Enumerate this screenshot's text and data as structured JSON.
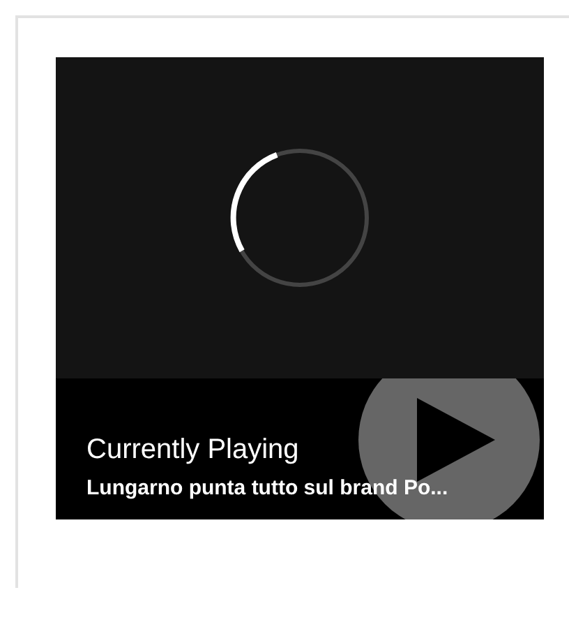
{
  "player": {
    "loading": true,
    "caption": {
      "label": "Currently Playing",
      "title": "Lungarno punta tutto sul brand Po..."
    }
  }
}
